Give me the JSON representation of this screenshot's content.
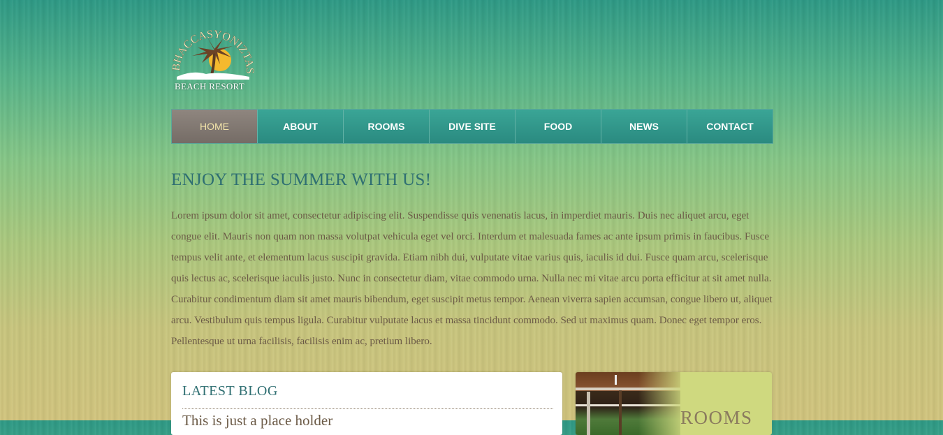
{
  "logo": {
    "arc_text": "BHACCASYONIZTAS",
    "sub_text": "BEACH RESORT"
  },
  "nav": {
    "items": [
      {
        "label": "HOME",
        "active": true
      },
      {
        "label": "ABOUT"
      },
      {
        "label": "ROOMS"
      },
      {
        "label": "DIVE SITE"
      },
      {
        "label": "FOOD"
      },
      {
        "label": "NEWS"
      },
      {
        "label": "CONTACT"
      }
    ]
  },
  "main": {
    "headline": "ENJOY THE SUMMER WITH US!",
    "intro": "Lorem ipsum dolor sit amet, consectetur adipiscing elit. Suspendisse quis venenatis lacus, in imperdiet mauris. Duis nec aliquet arcu, eget congue elit. Mauris non quam non massa volutpat vehicula eget vel orci. Interdum et malesuada fames ac ante ipsum primis in faucibus. Fusce tempus velit ante, et elementum lacus suscipit gravida. Etiam nibh dui, vulputate vitae varius quis, iaculis id dui. Fusce quam arcu, scelerisque quis lectus ac, scelerisque iaculis justo. Nunc in consectetur diam, vitae commodo urna. Nulla nec mi vitae arcu porta efficitur at sit amet nulla. Curabitur condimentum diam sit amet mauris bibendum, eget suscipit metus tempor. Aenean viverra sapien accumsan, congue libero ut, aliquet arcu. Vestibulum quis tempus ligula. Curabitur vulputate lacus et massa tincidunt commodo. Sed ut maximus quam. Donec eget tempor eros. Pellentesque ut urna facilisis, facilisis enim ac, pretium libero."
  },
  "blog": {
    "title": "LATEST BLOG",
    "post_title": "This is just a place holder"
  },
  "rooms_card": {
    "label": "ROOMS"
  },
  "colors": {
    "nav_teal": "#2f9a8c",
    "nav_active": "#837a73",
    "heading": "#2f6f72",
    "body_text": "#6b5a46"
  }
}
